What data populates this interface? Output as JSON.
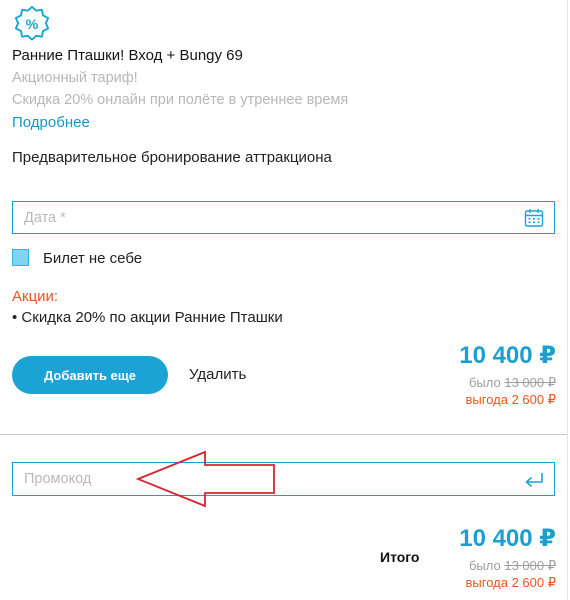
{
  "offer": {
    "badge_symbol": "%",
    "title": "Ранние Пташки! Вход + Bungy 69",
    "tariff": "Акционный тариф!",
    "discount_text": "Скидка 20% онлайн при полёте в утреннее время",
    "more_link": "Подробнее"
  },
  "booking": {
    "heading": "Предварительное бронирование аттракциона",
    "date_placeholder": "Дата *",
    "ticket_not_for_self": "Билет не себе",
    "ticket_not_for_self_checked": true,
    "promotions_heading": "Акции:",
    "promotions": [
      "• Скидка 20% по акции Ранние Пташки"
    ],
    "add_more_label": "Добавить еще",
    "remove_label": "Удалить",
    "price": "10 400 ₽",
    "was_label": "было",
    "old_price": "13 000 ₽",
    "savings": "выгода 2 600 ₽"
  },
  "promo": {
    "placeholder": "Промокод"
  },
  "total": {
    "label": "Итого",
    "price": "10 400 ₽",
    "was_label": "было",
    "old_price": "13 000 ₽",
    "savings": "выгода 2 600 ₽"
  },
  "colors": {
    "accent": "#1ba3d6",
    "promo": "#e8551f",
    "annotation_arrow": "#d6252e"
  },
  "icons": {
    "badge": "percent-badge-icon",
    "calendar": "calendar-icon",
    "enter": "enter-return-icon",
    "annotation": "left-arrow-annotation"
  }
}
